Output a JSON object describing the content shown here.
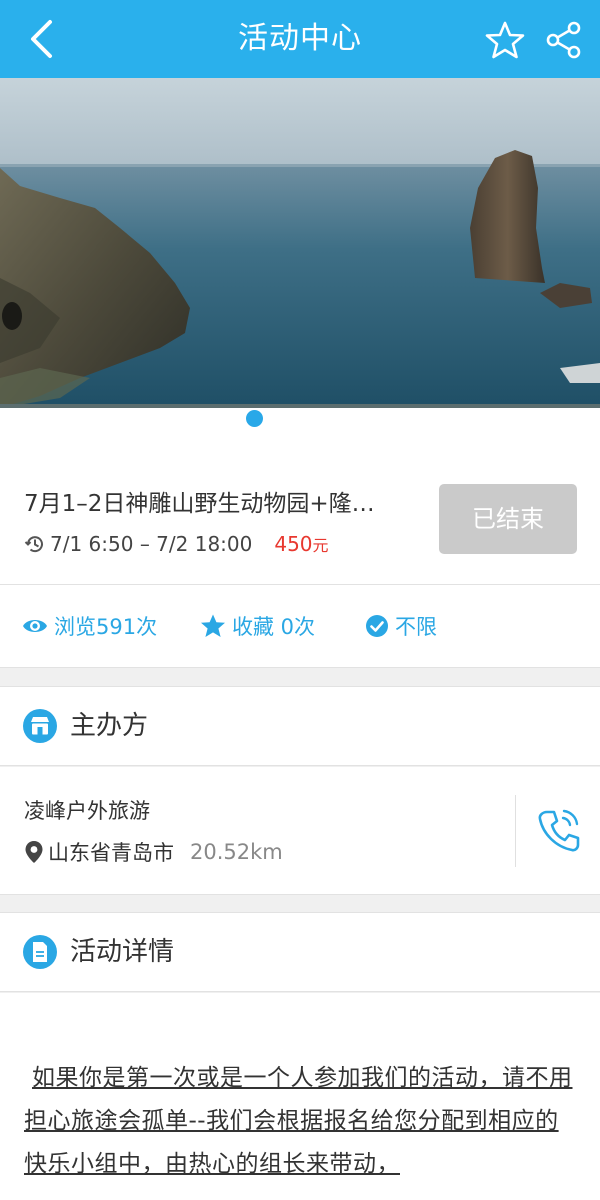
{
  "header": {
    "title": "活动中心",
    "icons": [
      "back-icon",
      "star-icon",
      "share-icon"
    ]
  },
  "banner": {
    "alt_icon": "sea-rock-photo",
    "page_indicator": "1"
  },
  "event": {
    "title": "7月1–2日神雕山野生动物园+隆…",
    "time": "7/1 6:50 – 7/2 18:00",
    "price": "450",
    "price_unit": "元",
    "status": "已结束"
  },
  "stats": {
    "views": "浏览591次",
    "favorites": "收藏 0次",
    "limit": "不限"
  },
  "organizer": {
    "section_label": "主办方",
    "name": "凌峰户外旅游",
    "location": "山东省青岛市",
    "distance": "20.52km"
  },
  "details": {
    "section_label": "活动详情",
    "text": "如果你是第一次或是一个人参加我们的活动，请不用担心旅途会孤单--我们会根据报名给您分配到相应的快乐小组中，由热心的组长来带动，"
  },
  "colors": {
    "primary": "#2ab0ec",
    "accent": "#2aa7e4",
    "price": "#e8382f",
    "disabled_button": "#cacaca"
  }
}
